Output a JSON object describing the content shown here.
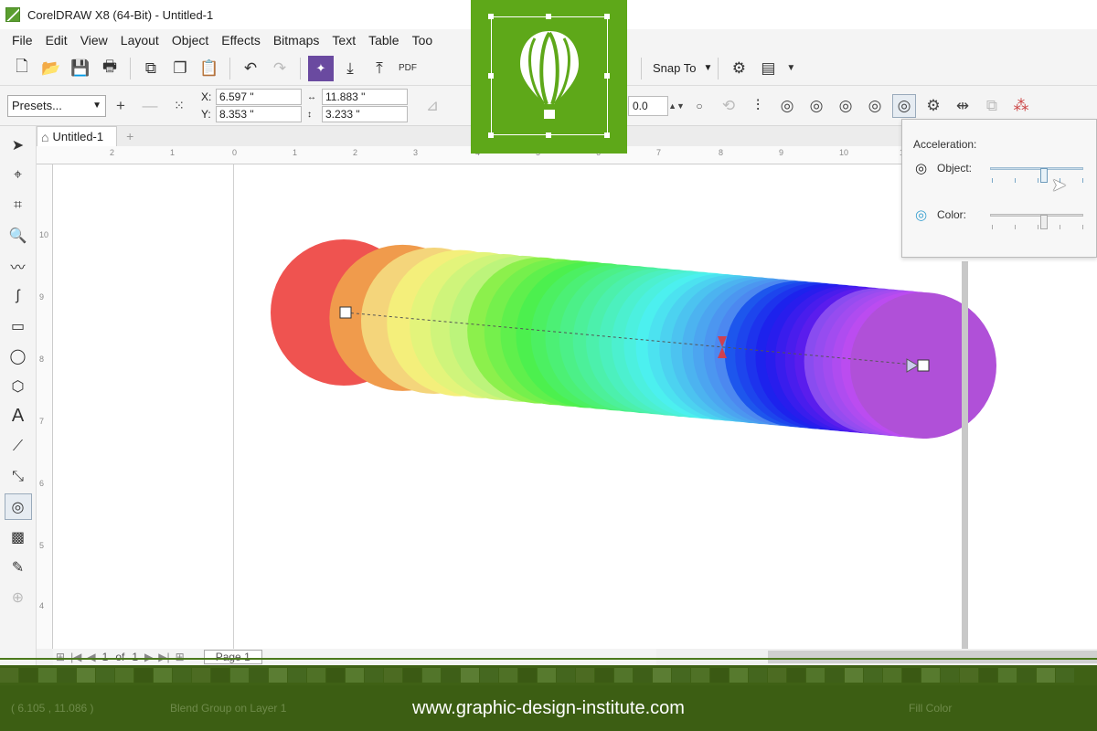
{
  "window": {
    "title": "CorelDRAW X8 (64-Bit) - Untitled-1"
  },
  "menu": [
    "File",
    "Edit",
    "View",
    "Layout",
    "Object",
    "Effects",
    "Bitmaps",
    "Text",
    "Table",
    "Too"
  ],
  "toolbar": {
    "pdf_label": "PDF",
    "snap_to_label": "Snap To"
  },
  "propbar": {
    "presets_label": "Presets...",
    "x_label": "X:",
    "x_value": "6.597 \"",
    "y_label": "Y:",
    "y_value": "8.353 \"",
    "w_value": "11.883 \"",
    "h_value": "3.233 \"",
    "offset_value": "0.0"
  },
  "document_tab": {
    "label": "Untitled-1"
  },
  "ruler": {
    "h_ticks": [
      "2",
      "1",
      "0",
      "1",
      "2",
      "3",
      "4",
      "5",
      "6",
      "7",
      "8",
      "9",
      "10",
      "11"
    ],
    "v_ticks": [
      "10",
      "9",
      "8",
      "7",
      "6",
      "5",
      "4"
    ]
  },
  "blend_popup": {
    "title": "Acceleration:",
    "object_label": "Object:",
    "color_label": "Color:",
    "object_accel": 0.62,
    "color_accel": 0.62
  },
  "page_nav": {
    "current": "1",
    "of_label": "of",
    "total": "1",
    "page_tab": "Page 1"
  },
  "status": {
    "coords": "( 6.105 , 11.086 )",
    "object_info": "Blend Group on Layer 1",
    "fill_label": "Fill Color"
  },
  "watermark": {
    "url": "www.graphic-design-institute.com"
  },
  "colors": {
    "brand_green": "#5ea819",
    "footer_green": "#3c5e13",
    "blend_start": "#ef5350",
    "blend_end": "#b050d8"
  }
}
